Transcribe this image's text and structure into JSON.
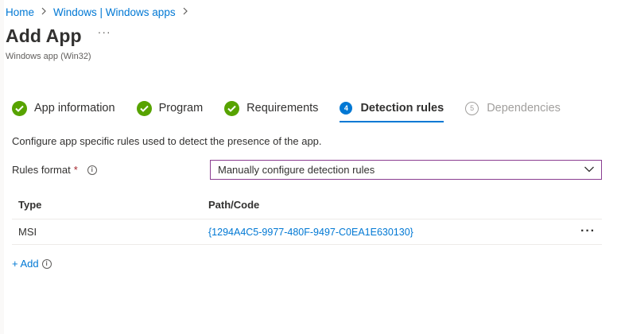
{
  "breadcrumb": {
    "items": [
      "Home",
      "Windows | Windows apps"
    ]
  },
  "header": {
    "title": "Add App",
    "more": "···",
    "subtitle": "Windows app (Win32)"
  },
  "steps": [
    {
      "label": "App information",
      "state": "done"
    },
    {
      "label": "Program",
      "state": "done"
    },
    {
      "label": "Requirements",
      "state": "done"
    },
    {
      "label": "Detection rules",
      "state": "current",
      "number": "4"
    },
    {
      "label": "Dependencies",
      "state": "pending",
      "number": "5"
    }
  ],
  "main": {
    "description": "Configure app specific rules used to detect the presence of the app.",
    "rules_format": {
      "label": "Rules format",
      "required_mark": "*",
      "info": "i",
      "selected": "Manually configure detection rules"
    },
    "table": {
      "headers": {
        "type": "Type",
        "path": "Path/Code"
      },
      "rows": [
        {
          "type": "MSI",
          "path": "{1294A4C5-9977-480F-9497-C0EA1E630130}",
          "more": "···"
        }
      ]
    },
    "add_label": "+ Add",
    "add_info": "i"
  },
  "colors": {
    "accent": "#0078d4",
    "success": "#57a300",
    "required": "#a4262c",
    "focus_border": "#8a3d91"
  },
  "icons": {
    "breadcrumb_separator": "chevron-right-icon",
    "done_step": "checkmark-circle-icon",
    "dropdown": "chevron-down-icon",
    "more": "more-horizontal-icon",
    "info": "info-icon"
  }
}
